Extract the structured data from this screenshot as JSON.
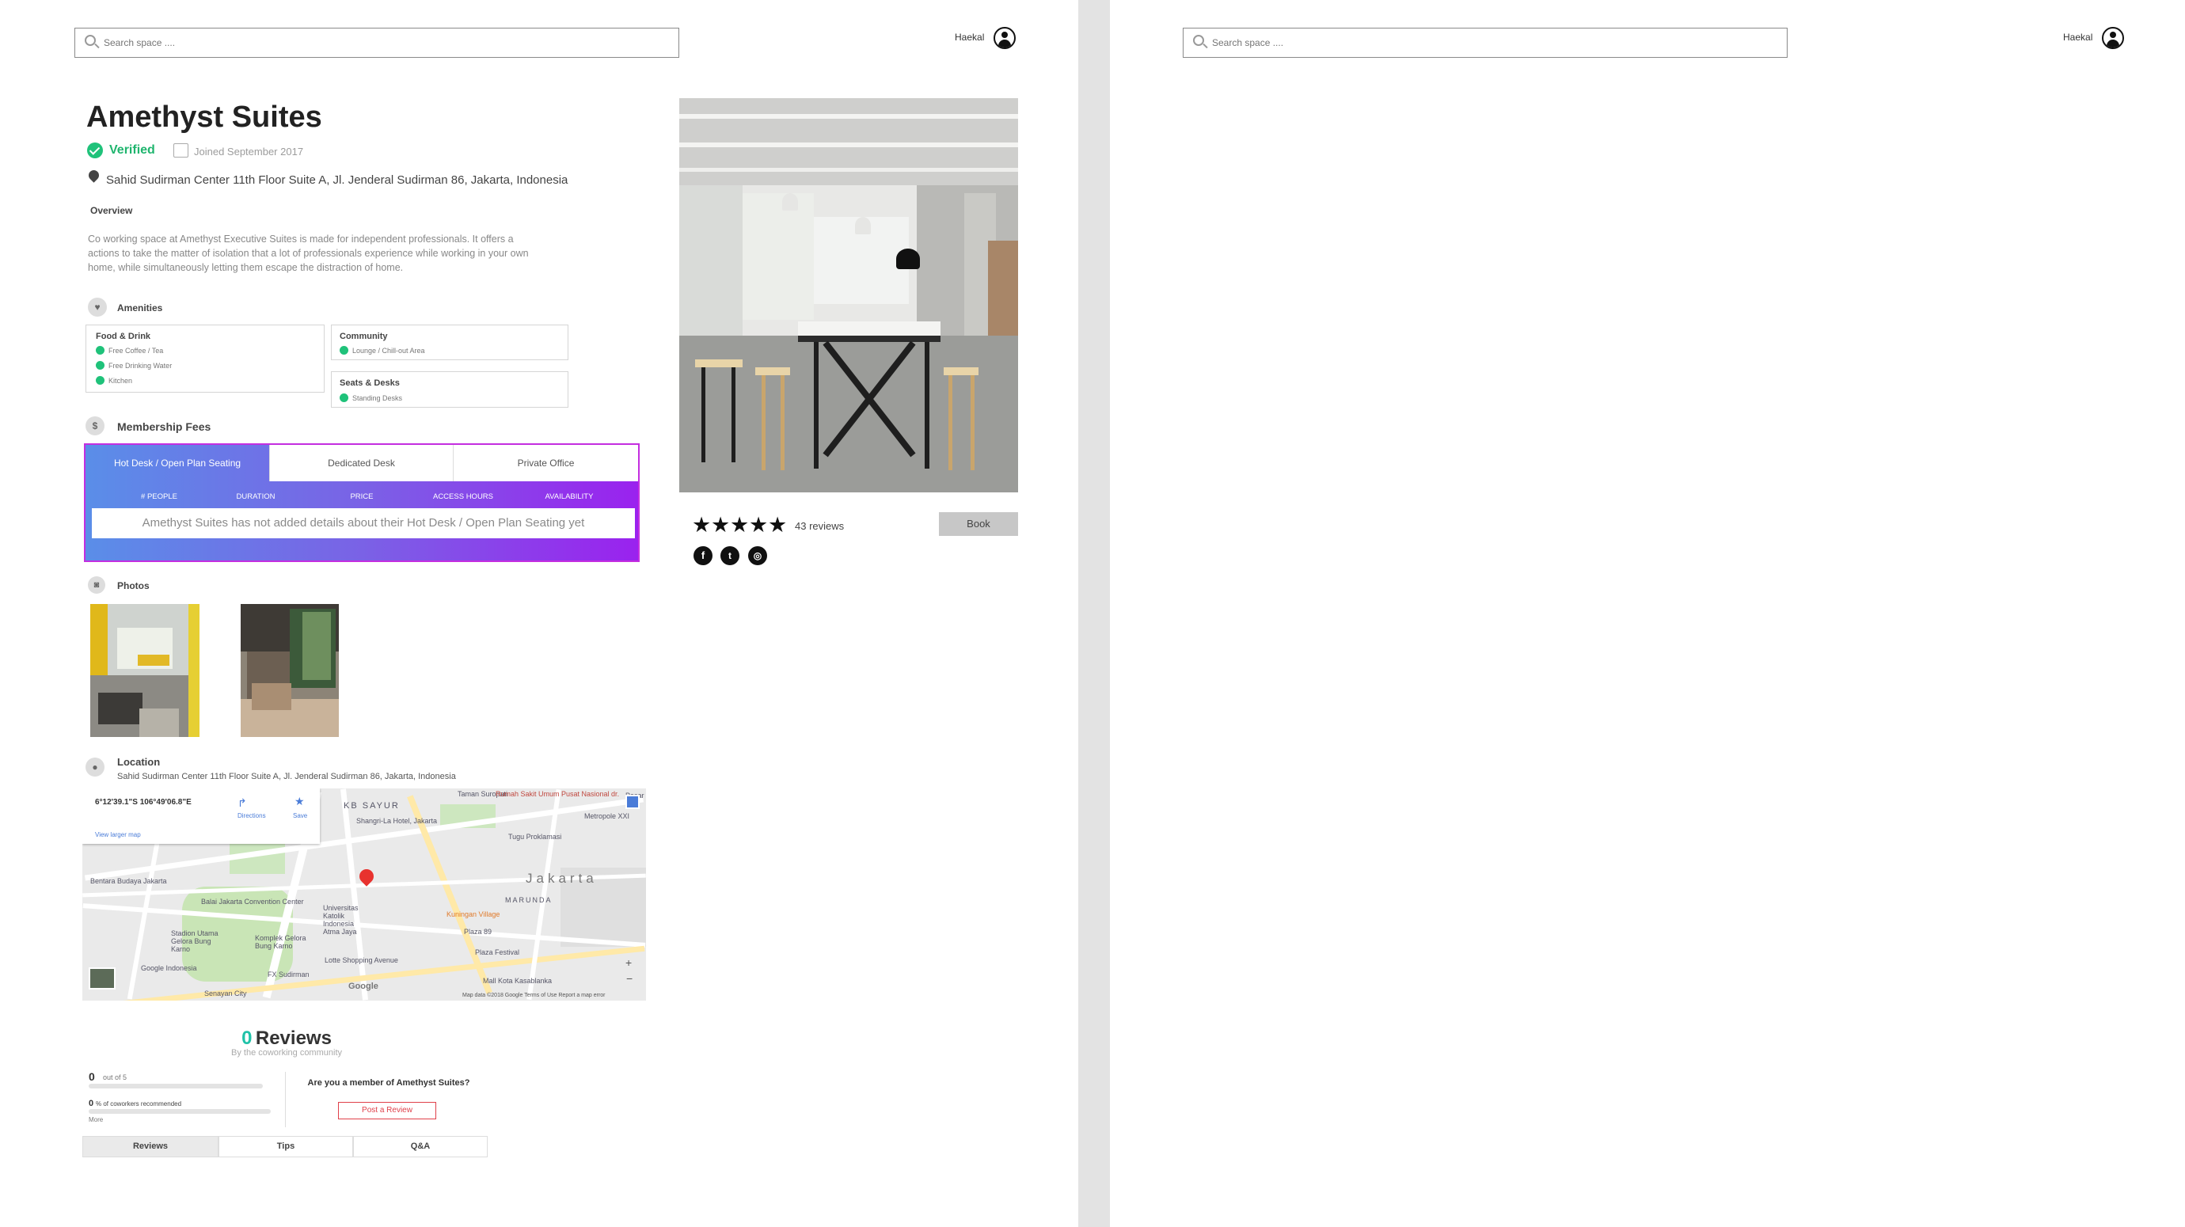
{
  "header": {
    "search_placeholder": "Search space ....",
    "user_name": "Haekal"
  },
  "listing": {
    "title": "Amethyst Suites",
    "verified_label": "Verified",
    "joined_label": "Joined September 2017",
    "address": "Sahid Sudirman Center 11th Floor Suite A, Jl. Jenderal Sudirman 86, Jakarta, Indonesia",
    "overview_label": "Overview",
    "overview_text": "Co working space at Amethyst Executive Suites is made for independent professionals. It offers a actions to take the matter of isolation that a lot of professionals experience while working in your own home, while simultaneously letting them escape the distraction of home."
  },
  "amenities": {
    "label": "Amenities",
    "groups": [
      {
        "title": "Food & Drink",
        "items": [
          "Free Coffee / Tea",
          "Free Drinking Water",
          "Kitchen"
        ]
      },
      {
        "title": "Community",
        "items": [
          "Lounge / Chill-out Area"
        ]
      },
      {
        "title": "Seats & Desks",
        "items": [
          "Standing Desks"
        ]
      }
    ]
  },
  "membership": {
    "label": "Membership Fees",
    "tabs": [
      "Hot Desk / Open Plan Seating",
      "Dedicated Desk",
      "Private Office"
    ],
    "columns": [
      "# PEOPLE",
      "DURATION",
      "PRICE",
      "ACCESS HOURS",
      "AVAILABILITY"
    ],
    "empty_message": "Amethyst Suites has not added details about their Hot Desk / Open Plan Seating yet"
  },
  "photos": {
    "label": "Photos"
  },
  "location": {
    "label": "Location",
    "address": "Sahid Sudirman Center 11th Floor Suite A, Jl. Jenderal Sudirman 86, Jakarta, Indonesia",
    "map": {
      "coords": "6°12'39.1\"S 106°49'06.8\"E",
      "directions": "Directions",
      "save": "Save",
      "larger_map": "View larger map",
      "labels": [
        "KB SAYUR",
        "Taman Suropati",
        "Rumah Sakit Umum Pusat Nasional dr.",
        "Shangri-La Hotel, Jakarta",
        "Metropole XXI",
        "Tugu Proklamasi",
        "Bentara Budaya Jakarta",
        "Jakarta",
        "Balai Jakarta Convention Center",
        "MARUNDA",
        "Universitas Katolik Indonesia Atma Jaya",
        "Kuningan Village",
        "Plaza 89",
        "Stadion Utama Gelora Bung Karno",
        "Komplek Gelora Bung Karno",
        "Plaza Festival",
        "Google Indonesia",
        "Lotte Shopping Avenue",
        "FX Sudirman",
        "Mall Kota Kasablanka",
        "Senayan City",
        "Pasar"
      ],
      "footer": "Map data ©2018 Google   Terms of Use   Report a map error",
      "google": "Google"
    }
  },
  "reviews": {
    "count": "0",
    "title": "Reviews",
    "subtitle": "By the coworking community",
    "score": "0",
    "score_suffix": "out of 5",
    "recommend_pct": "0",
    "recommend_suffix": "% of coworkers recommended",
    "more": "More",
    "member_question": "Are you a member of Amethyst Suites?",
    "post_button": "Post a Review",
    "tabs": [
      "Reviews",
      "Tips",
      "Q&A"
    ]
  },
  "sidebar": {
    "rating": 5,
    "reviews_count": "43 reviews",
    "book_label": "Book",
    "social": [
      "facebook",
      "twitter",
      "instagram"
    ]
  },
  "colors": {
    "verified": "#1fb56e",
    "gradient_start": "#5a8ee8",
    "gradient_end": "#9a22ee",
    "post_button": "#e0404a",
    "reviews_accent": "#1fc2a8"
  }
}
